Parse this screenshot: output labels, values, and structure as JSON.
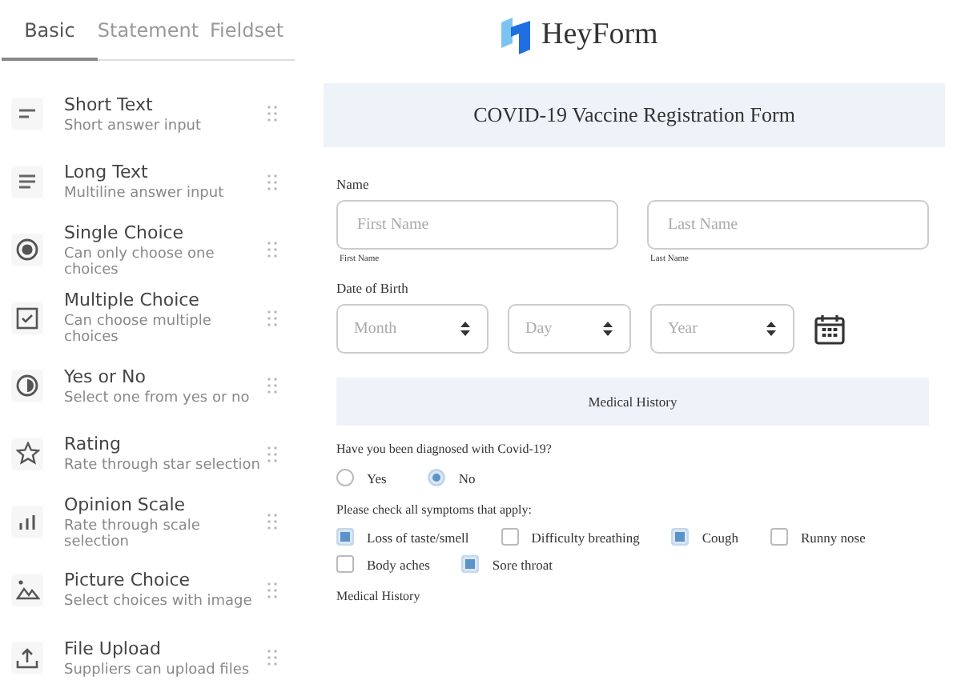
{
  "sidebar": {
    "tabs": [
      {
        "label": "Basic",
        "selected": true
      },
      {
        "label": "Statement",
        "selected": false
      },
      {
        "label": "Fieldset",
        "selected": false
      }
    ],
    "items": [
      {
        "kind": "short",
        "title": "Short Text",
        "description": "Short answer input"
      },
      {
        "kind": "long",
        "title": "Long Text",
        "description": "Multiline answer input"
      },
      {
        "kind": "single",
        "title": "Single Choice",
        "description": "Can only choose one choices"
      },
      {
        "kind": "multiple",
        "title": "Multiple Choice",
        "description": "Can choose multiple choices"
      },
      {
        "kind": "yesno",
        "title": "Yes or No",
        "description": "Select one from yes or no"
      },
      {
        "kind": "rating",
        "title": "Rating",
        "description": "Rate through star selection"
      },
      {
        "kind": "scale",
        "title": "Opinion Scale",
        "description": "Rate through scale selection"
      },
      {
        "kind": "picture",
        "title": "Picture Choice",
        "description": "Select choices with image"
      },
      {
        "kind": "upload",
        "title": "File Upload",
        "description": "Suppliers can upload files"
      }
    ]
  },
  "form": {
    "brand": "HeyForm",
    "title": "COVID-19 Vaccine Registration Form",
    "name_label": "Name",
    "name_fields": [
      {
        "placeholder": "First Name",
        "sublabel": "First Name"
      },
      {
        "placeholder": "Last Name",
        "sublabel": "Last Name"
      }
    ],
    "dob_label": "Date of Birth",
    "dob_selects": [
      {
        "placeholder": "Month"
      },
      {
        "placeholder": "Day"
      },
      {
        "placeholder": "Year"
      }
    ],
    "section": "Medical History",
    "question": "Have you been diagnosed with Covid-19?",
    "radios": [
      {
        "label": "Yes",
        "selected": false
      },
      {
        "label": "No",
        "selected": true
      }
    ],
    "symptoms_label": "Please check all symptoms that apply:",
    "symptoms": [
      {
        "label": "Loss of taste/smell",
        "checked": true
      },
      {
        "label": "Difficulty breathing",
        "checked": false
      },
      {
        "label": "Cough",
        "checked": true
      },
      {
        "label": "Runny nose",
        "checked": false
      },
      {
        "label": "Body aches",
        "checked": false
      },
      {
        "label": "Sore throat",
        "checked": true
      }
    ],
    "history_label": "Medical History"
  }
}
